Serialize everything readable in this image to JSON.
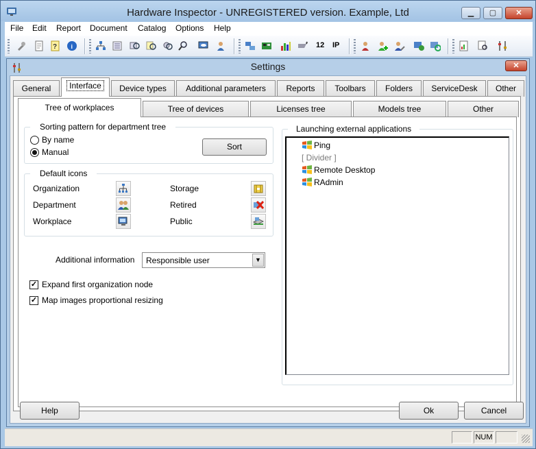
{
  "window": {
    "title": "Hardware Inspector - UNREGISTERED version. Example, Ltd",
    "minimize_glyph": "▁",
    "maximize_glyph": "▢",
    "close_glyph": "✕"
  },
  "menu": [
    "File",
    "Edit",
    "Report",
    "Document",
    "Catalog",
    "Options",
    "Help"
  ],
  "toolbar": {
    "number_label": "12",
    "ip_label": "IP"
  },
  "dialog": {
    "title": "Settings",
    "close_glyph": "✕",
    "tabs": [
      "General",
      "Interface",
      "Device types",
      "Additional parameters",
      "Reports",
      "Toolbars",
      "Folders",
      "ServiceDesk",
      "Other"
    ],
    "active_tab": "Interface",
    "subtabs": [
      "Tree of workplaces",
      "Tree of devices",
      "Licenses tree",
      "Models tree",
      "Other"
    ],
    "active_subtab": "Tree of workplaces",
    "sorting": {
      "label": "Sorting pattern for department tree",
      "options": [
        "By name",
        "Manual"
      ],
      "selected": "Manual",
      "sort_button": "Sort"
    },
    "default_icons": {
      "label": "Default icons",
      "items": [
        "Organization",
        "Department",
        "Workplace",
        "Storage",
        "Retired",
        "Public"
      ]
    },
    "additional_info": {
      "label": "Additional information",
      "value": "Responsible user",
      "arrow": "▼"
    },
    "checkboxes": [
      {
        "label": "Expand first organization node",
        "checked": true
      },
      {
        "label": "Map images proportional resizing",
        "checked": true
      }
    ],
    "check_glyph": "✓",
    "launching": {
      "label": "Launching external applications",
      "items": [
        "Ping",
        "[ Divider ]",
        "Remote Desktop",
        "RAdmin"
      ]
    },
    "buttons": {
      "help": "Help",
      "ok": "Ok",
      "cancel": "Cancel"
    }
  },
  "statusbar": {
    "num": "NUM"
  }
}
